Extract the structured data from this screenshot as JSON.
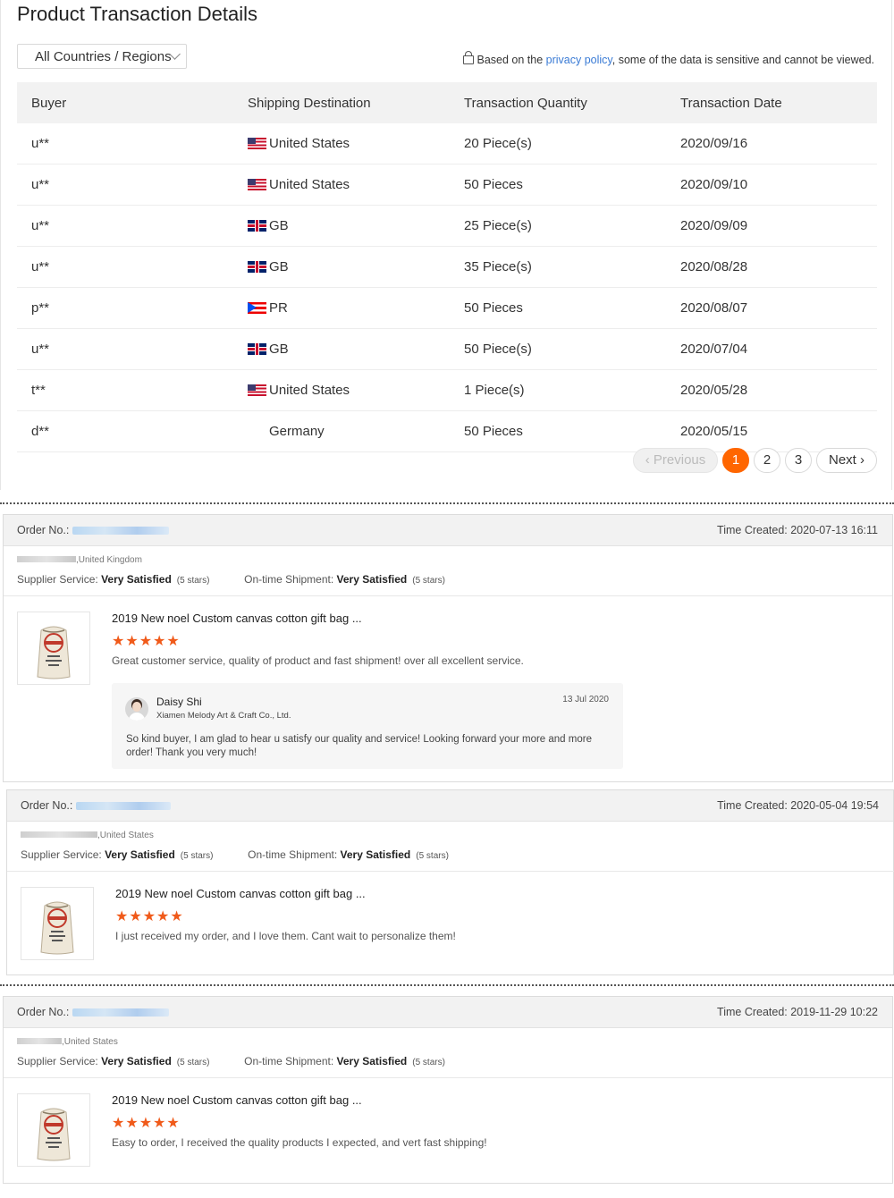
{
  "header": {
    "title": "Product Transaction Details",
    "country_filter": "All Countries / Regions",
    "privacy_prefix": "Based on the ",
    "privacy_link": "privacy policy",
    "privacy_suffix": ", some of the data is sensitive and cannot be viewed."
  },
  "table": {
    "columns": [
      "Buyer",
      "Shipping Destination",
      "Transaction Quantity",
      "Transaction Date"
    ],
    "rows": [
      {
        "buyer": "u**",
        "flag": "us",
        "destination": "United States",
        "quantity": "20 Piece(s)",
        "date": "2020/09/16"
      },
      {
        "buyer": "u**",
        "flag": "us",
        "destination": "United States",
        "quantity": "50 Pieces",
        "date": "2020/09/10"
      },
      {
        "buyer": "u**",
        "flag": "gb",
        "destination": "GB",
        "quantity": "25 Piece(s)",
        "date": "2020/09/09"
      },
      {
        "buyer": "u**",
        "flag": "gb",
        "destination": "GB",
        "quantity": "35 Piece(s)",
        "date": "2020/08/28"
      },
      {
        "buyer": "p**",
        "flag": "pr",
        "destination": "PR",
        "quantity": "50 Pieces",
        "date": "2020/08/07"
      },
      {
        "buyer": "u**",
        "flag": "gb",
        "destination": "GB",
        "quantity": "50 Piece(s)",
        "date": "2020/07/04"
      },
      {
        "buyer": "t**",
        "flag": "us",
        "destination": "United States",
        "quantity": "1 Piece(s)",
        "date": "2020/05/28"
      },
      {
        "buyer": "d**",
        "flag": "none",
        "destination": "Germany",
        "quantity": "50 Pieces",
        "date": "2020/05/15"
      }
    ]
  },
  "pagination": {
    "previous": "Previous",
    "pages": [
      "1",
      "2",
      "3"
    ],
    "current": "1",
    "next": "Next"
  },
  "reviews": [
    {
      "order_label": "Order No.:",
      "time_created": "Time Created: 2020-07-13 16:11",
      "location": ",United Kingdom",
      "supplier_label": "Supplier Service:",
      "supplier_value": "Very Satisfied",
      "supplier_stars": "(5 stars)",
      "shipment_label": "On-time Shipment:",
      "shipment_value": "Very Satisfied",
      "shipment_stars": "(5 stars)",
      "product": "2019 New noel Custom canvas cotton gift bag ...",
      "stars": "★★★★★",
      "comment": "Great customer service, quality of product and fast shipment! over all excellent service.",
      "reply": {
        "name": "Daisy Shi",
        "company": "Xiamen Melody Art & Craft Co., Ltd.",
        "date": "13 Jul 2020",
        "text": "So kind buyer, I am glad to hear u satisfy our quality and service! Looking forward your more and more order! Thank you very much!"
      }
    },
    {
      "order_label": "Order No.:",
      "time_created": "Time Created: 2020-05-04 19:54",
      "location": ",United States",
      "supplier_label": "Supplier Service:",
      "supplier_value": "Very Satisfied",
      "supplier_stars": "(5 stars)",
      "shipment_label": "On-time Shipment:",
      "shipment_value": "Very Satisfied",
      "shipment_stars": "(5 stars)",
      "product": "2019 New noel Custom canvas cotton gift bag ...",
      "stars": "★★★★★",
      "comment": "I just received my order, and I love them. Cant wait to personalize them!"
    },
    {
      "order_label": "Order No.:",
      "time_created": "Time Created: 2019-11-29 10:22",
      "location": ",United States",
      "supplier_label": "Supplier Service:",
      "supplier_value": "Very Satisfied",
      "supplier_stars": "(5 stars)",
      "shipment_label": "On-time Shipment:",
      "shipment_value": "Very Satisfied",
      "shipment_stars": "(5 stars)",
      "product": "2019 New noel Custom canvas cotton gift bag ...",
      "stars": "★★★★★",
      "comment": "Easy to order, I received the quality products I expected, and vert fast shipping!"
    }
  ],
  "colors": {
    "accent": "#ff6600",
    "star": "#f05a1a",
    "link": "#3a7bd5"
  }
}
